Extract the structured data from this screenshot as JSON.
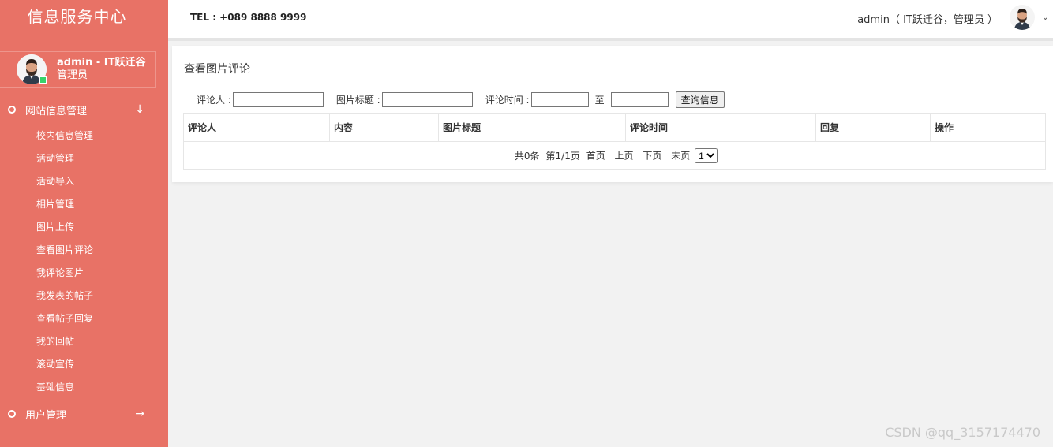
{
  "sidebar": {
    "brand": "信息服务中心",
    "profile": {
      "name": "admin - IT跃迁谷",
      "role": "管理员"
    },
    "groups": [
      {
        "label": "网站信息管理",
        "arrow": "↓",
        "items": [
          "校内信息管理",
          "活动管理",
          "活动导入",
          "相片管理",
          "图片上传",
          "查看图片评论",
          "我评论图片",
          "我发表的帖子",
          "查看帖子回复",
          "我的回帖",
          "滚动宣传",
          "基础信息"
        ]
      },
      {
        "label": "用户管理",
        "arrow": "→"
      }
    ]
  },
  "topbar": {
    "tel": "TEL : +089 8888 9999",
    "user": "admin（ IT跃迁谷，管理员 ）",
    "caret": "⌄"
  },
  "main": {
    "title": "查看图片评论",
    "filter": {
      "commenter_label": "评论人 :",
      "commenter_value": "",
      "pic_title_label": "图片标题 :",
      "pic_title_value": "",
      "time_label": "评论时间 :",
      "time_from": "",
      "to_label": "至",
      "time_to": "",
      "search_button": "查询信息"
    },
    "table": {
      "columns": [
        "评论人",
        "内容",
        "图片标题",
        "评论时间",
        "回复",
        "操作"
      ],
      "rows": []
    },
    "pager": {
      "total": "共0条",
      "page": "第1/1页",
      "first": "首页",
      "prev": "上页",
      "next": "下页",
      "last": "末页",
      "selected": "1",
      "options": [
        "1"
      ]
    }
  },
  "watermark": "CSDN @qq_3157174470"
}
